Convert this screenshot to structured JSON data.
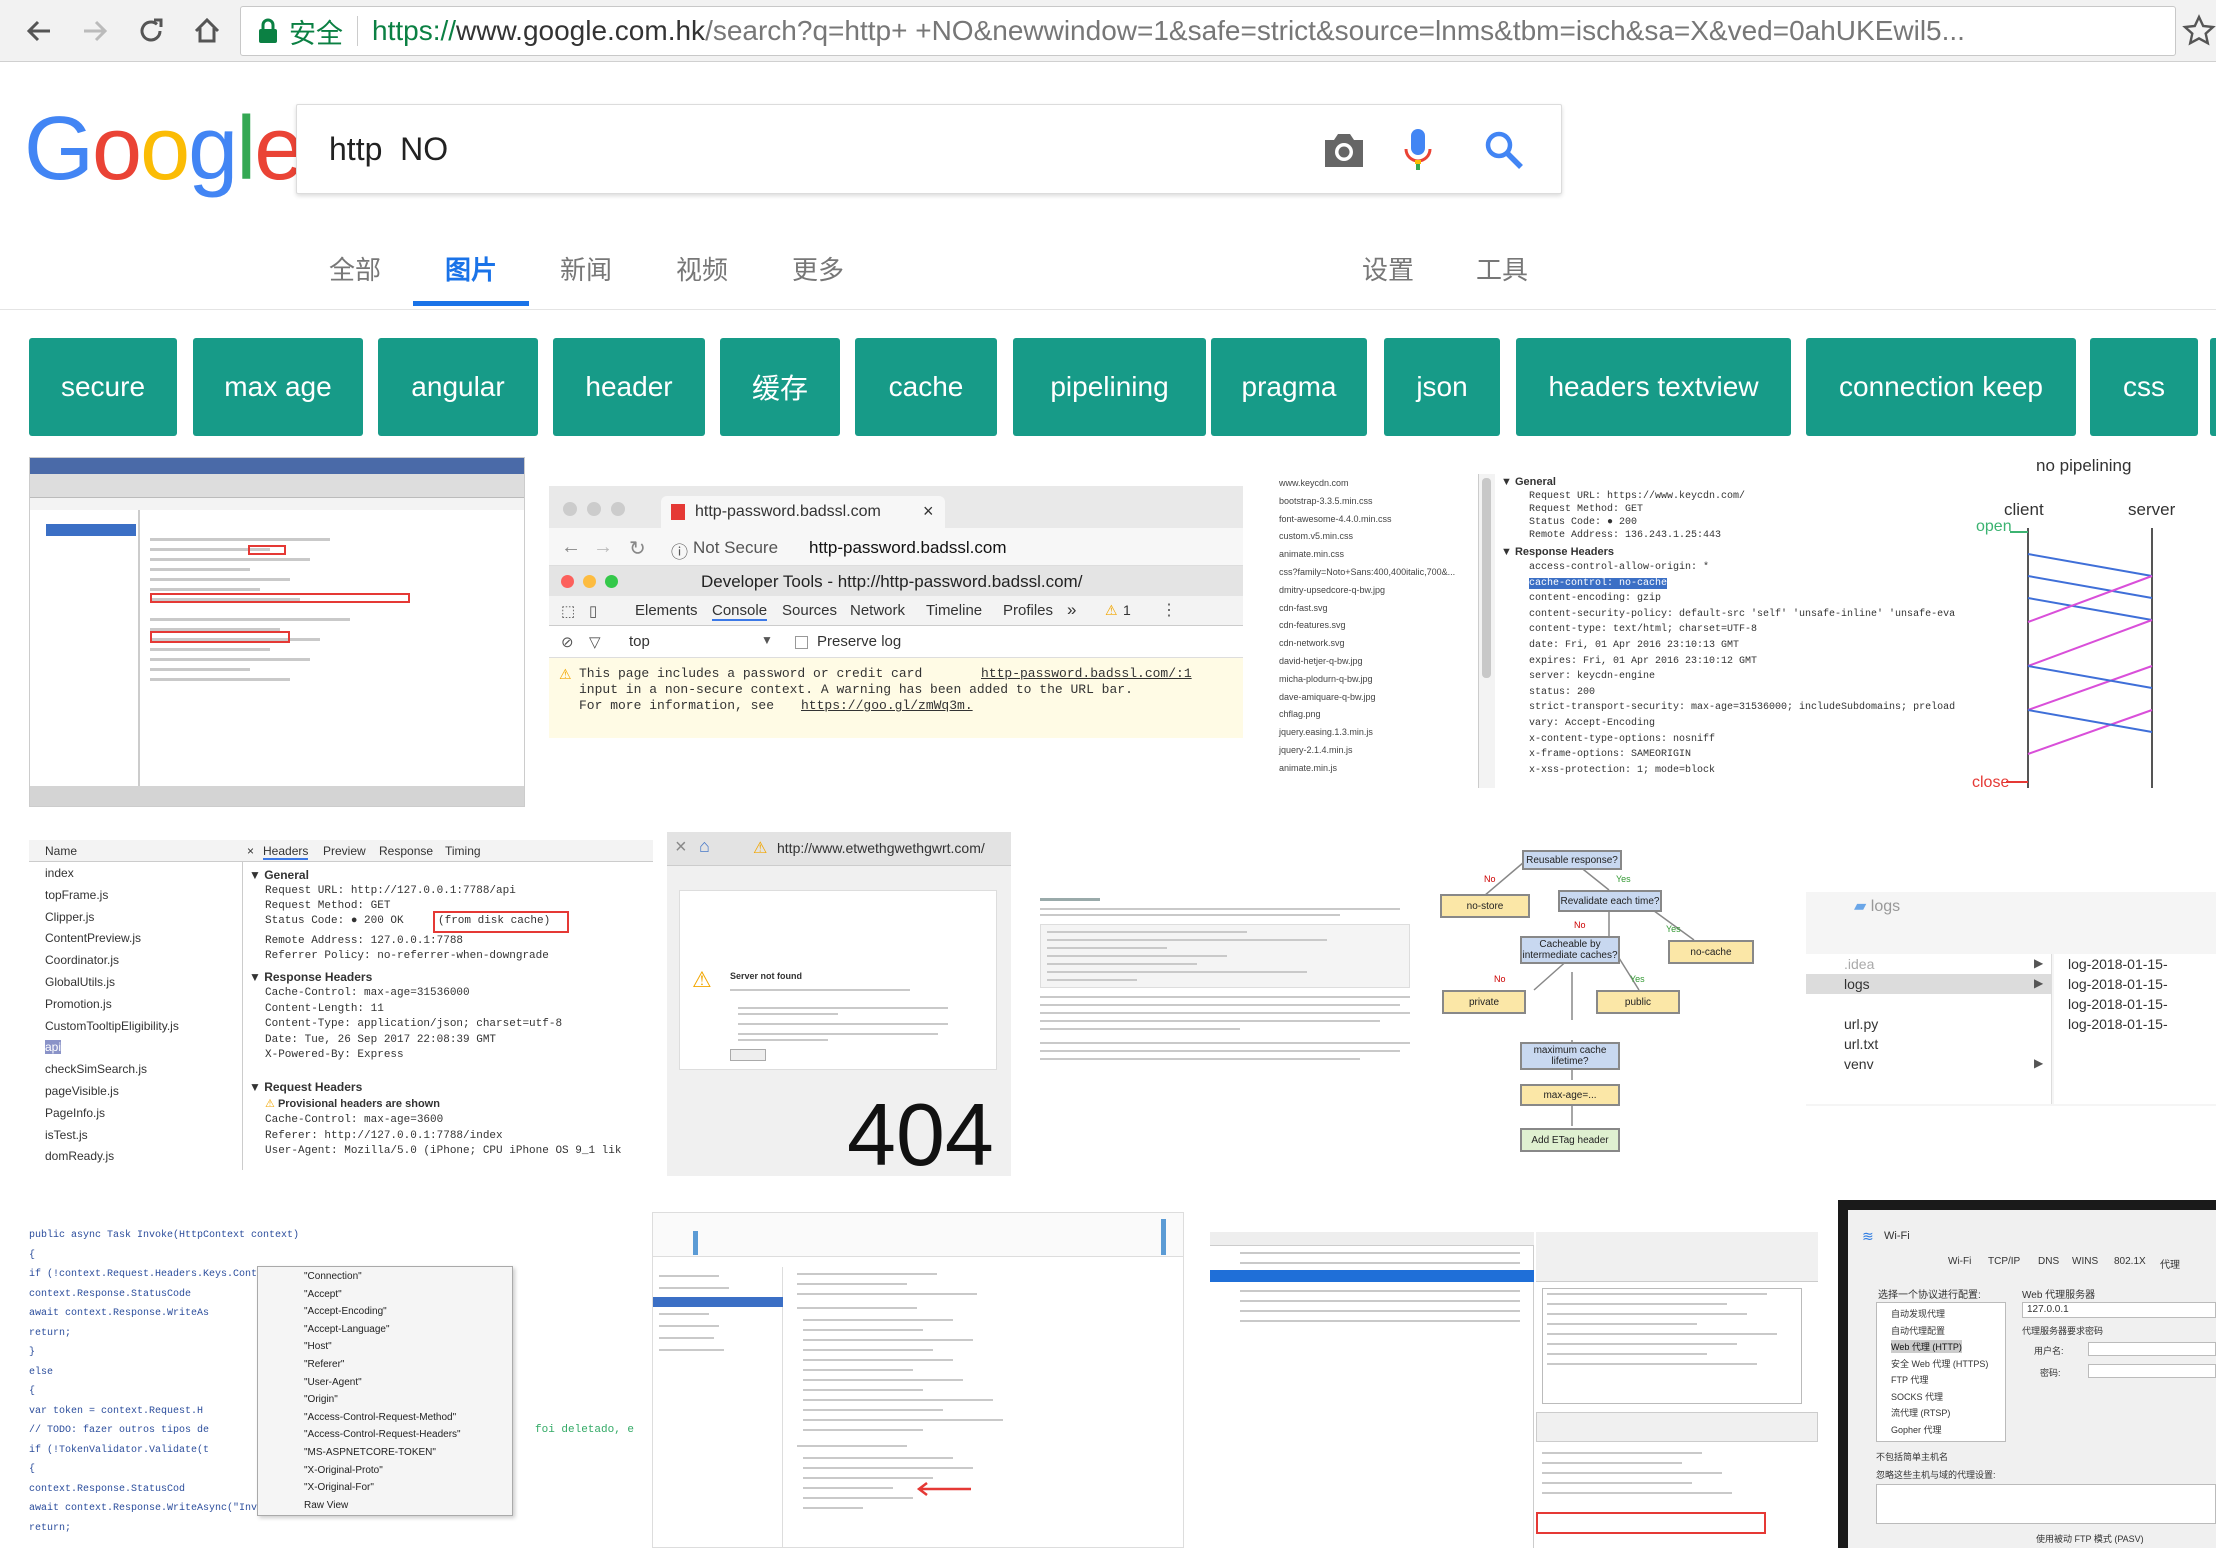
{
  "browser": {
    "secure_label": "安全",
    "url_scheme": "https://",
    "url_host": "www.google.com.hk",
    "url_path": "/search?q=http+ +NO&newwindow=1&safe=strict&source=lnms&tbm=isch&sa=X&ved=0ahUKEwil5..."
  },
  "logo": [
    "G",
    "o",
    "o",
    "g",
    "l",
    "e"
  ],
  "search": {
    "query": "http  NO"
  },
  "tabs": {
    "all": "全部",
    "images": "图片",
    "news": "新闻",
    "video": "视频",
    "more": "更多",
    "settings": "设置",
    "tools": "工具"
  },
  "chips": [
    "secure",
    "max age",
    "angular",
    "header",
    "缓存",
    "cache",
    "pipelining",
    "pragma",
    "json",
    "headers textview",
    "connection keep",
    "css"
  ],
  "results": {
    "badssl": {
      "tab_title": "http-password.badssl.com",
      "not_secure": "Not Secure",
      "address": "http-password.badssl.com",
      "devtools_title": "Developer Tools - http://http-password.badssl.com/",
      "panels": [
        "Elements",
        "Console",
        "Sources",
        "Network",
        "Timeline",
        "Profiles",
        "»"
      ],
      "warning_count": "1",
      "context": "top",
      "preserve_log": "Preserve log",
      "warning_line1": "This page includes a password or credit card",
      "warning_link1": "http-password.badssl.com/:1",
      "warning_line2": "input in a non-secure context. A warning has been added to the URL bar.",
      "warning_line3": "For more information, see",
      "warning_link2": "https://goo.gl/zmWq3m."
    },
    "keycdn": {
      "general": "General",
      "request_url": "Request URL: https://www.keycdn.com/",
      "request_method": "Request Method: GET",
      "status_code": "Status Code: ● 200",
      "remote_address": "Remote Address: 136.243.1.25:443",
      "response_headers": "Response Headers",
      "header_lines": [
        "access-control-allow-origin: *",
        "cache-control: no-cache",
        "content-encoding: gzip",
        "content-security-policy: default-src 'self' 'unsafe-inline' 'unsafe-eva",
        "content-type: text/html; charset=UTF-8",
        "date: Fri, 01 Apr 2016 23:10:13 GMT",
        "expires: Fri, 01 Apr 2016 23:10:12 GMT",
        "server: keycdn-engine",
        "status: 200",
        "strict-transport-security: max-age=31536000; includeSubdomains; preload",
        "vary: Accept-Encoding",
        "x-content-type-options: nosniff",
        "x-frame-options: SAMEORIGIN",
        "x-xss-protection: 1; mode=block"
      ],
      "files": [
        "www.keycdn.com",
        "bootstrap-3.3.5.min.css",
        "font-awesome-4.4.0.min.css",
        "custom.v5.min.css",
        "animate.min.css",
        "css?family=Noto+Sans:400,400italic,700&...",
        "dmitry-upsedcore-q-bw.jpg",
        "cdn-fast.svg",
        "cdn-features.svg",
        "cdn-network.svg",
        "david-hetjer-q-bw.jpg",
        "micha-plodurn-q-bw.jpg",
        "dave-amiquare-q-bw.jpg",
        "chflag.png",
        "jquery.easing.1.3.min.js",
        "jquery-2.1.4.min.js",
        "animate.min.js"
      ]
    },
    "pipelining": {
      "title": "no pipelining",
      "client": "client",
      "server": "server",
      "open": "open",
      "close": "close"
    },
    "disk_cache": {
      "name_header": "Name",
      "tabs": [
        "Headers",
        "Preview",
        "Response",
        "Timing"
      ],
      "files": [
        "index",
        "topFrame.js",
        "Clipper.js",
        "ContentPreview.js",
        "Coordinator.js",
        "GlobalUtils.js",
        "Promotion.js",
        "CustomTooltipEligibility.js",
        "api",
        "checkSimSearch.js",
        "pageVisible.js",
        "PageInfo.js",
        "isTest.js",
        "domReady.js"
      ],
      "general": "General",
      "request_url": "Request URL: http://127.0.0.1:7788/api",
      "request_method": "Request Method: GET",
      "status_code": "Status Code: ● 200 OK",
      "from_disk_cache": "(from disk cache)",
      "remote_address": "Remote Address: 127.0.0.1:7788",
      "referrer_policy": "Referrer Policy: no-referrer-when-downgrade",
      "response_headers": "Response Headers",
      "response_lines": [
        "Cache-Control: max-age=31536000",
        "Content-Length: 11",
        "Content-Type: application/json; charset=utf-8",
        "Date: Tue, 26 Sep 2017 22:08:39 GMT",
        "X-Powered-By: Express"
      ],
      "request_headers": "Request Headers",
      "provisional": "Provisional headers are shown",
      "request_lines": [
        "Cache-Control: max-age=3600",
        "Referer: http://127.0.0.1:7788/index",
        "User-Agent: Mozilla/5.0 (iPhone; CPU iPhone OS 9_1 lik"
      ]
    },
    "not_found": {
      "url": "http://www.etwethgwethgwrt.com/",
      "title": "Server not found",
      "code": "404"
    },
    "flowchart": {
      "nodes": [
        "Reusable response?",
        "no-store",
        "Revalidate each time?",
        "Cacheable by intermediate caches?",
        "no-cache",
        "private",
        "public",
        "maximum cache lifetime?",
        "max-age=...",
        "Add ETag header"
      ],
      "yes": "Yes",
      "no": "No"
    },
    "finder": {
      "folder_title": "logs",
      "items": [
        ".idea",
        "logs",
        "url.py",
        "url.txt",
        "venv"
      ],
      "logs": [
        "log-2018-01-15-",
        "log-2018-01-15-",
        "log-2018-01-15-",
        "log-2018-01-15-"
      ]
    },
    "wifi": {
      "title": "Wi-Fi",
      "tabs": [
        "Wi-Fi",
        "TCP/IP",
        "DNS",
        "WINS",
        "802.1X",
        "代理"
      ],
      "protocol_label": "选择一个协议进行配置:",
      "protocols": [
        "自动发现代理",
        "自动代理配置",
        "Web 代理 (HTTP)",
        "安全 Web 代理 (HTTPS)",
        "FTP 代理",
        "SOCKS 代理",
        "流代理 (RTSP)",
        "Gopher 代理"
      ],
      "web_proxy": "Web 代理服务器",
      "proxy_value": "127.0.0.1",
      "needs_password": "代理服务器要求密码",
      "username": "用户名:",
      "password": "密码:",
      "exclude_simple": "不包括简单主机名",
      "bypass": "忽略这些主机与域的代理设置:",
      "pasv": "使用被动 FTP 模式 (PASV)"
    },
    "code": {
      "lines": [
        "public async Task Invoke(HttpContext context)",
        "{",
        "  if (!context.Request.Headers.Keys.Contains(\"authentication\"))",
        "      context.Response.StatusCode",
        "      await context.Response.WriteAs",
        "      return;",
        "  }",
        "  else",
        "  {",
        "    var token = context.Request.H",
        "    // TODO: fazer outros tipos de",
        "    if (!TokenValidator.Validate(t",
        "    {",
        "      context.Response.StatusCod",
        "      await context.Response.WriteAsync(\"Invalid authentication\");",
        "      return;"
      ],
      "popup": [
        "\"Connection\"",
        "\"Accept\"",
        "\"Accept-Encoding\"",
        "\"Accept-Language\"",
        "\"Host\"",
        "\"Referer\"",
        "\"User-Agent\"",
        "\"Origin\"",
        "\"Access-Control-Request-Method\"",
        "\"Access-Control-Request-Headers\"",
        "\"MS-ASPNETCORE-TOKEN\"",
        "\"X-Original-Proto\"",
        "\"X-Original-For\"",
        "Raw View"
      ],
      "comment_tail": "foi deletado, e"
    }
  }
}
